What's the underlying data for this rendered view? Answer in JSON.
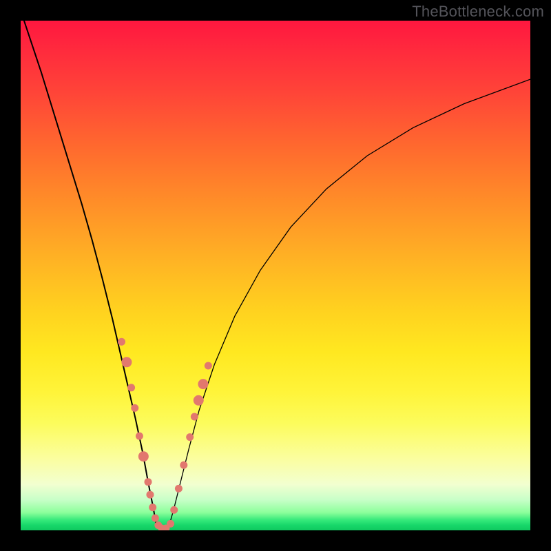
{
  "watermark": {
    "text": "TheBottleneck.com"
  },
  "chart_data": {
    "type": "line",
    "title": "",
    "xlabel": "",
    "ylabel": "",
    "xlim": [
      0,
      100
    ],
    "ylim": [
      0,
      100
    ],
    "series": [
      {
        "name": "curve-left",
        "x": [
          0,
          4,
          8,
          12,
          14,
          16,
          18,
          19.5,
          21,
          22.5,
          24,
          25,
          26,
          26.7
        ],
        "y": [
          102,
          90,
          77,
          64,
          57,
          49.5,
          41.5,
          35,
          28.5,
          22,
          15,
          9.5,
          4.5,
          0.5
        ]
      },
      {
        "name": "curve-right",
        "x": [
          29,
          30,
          31.5,
          33,
          35,
          38,
          42,
          47,
          53,
          60,
          68,
          77,
          87,
          100
        ],
        "y": [
          0.5,
          4,
          10,
          16,
          23.5,
          32.5,
          42,
          51,
          59.5,
          67,
          73.5,
          79,
          83.7,
          88.5
        ]
      }
    ],
    "markers": [
      {
        "x": 19.8,
        "y": 37,
        "r": 5.5
      },
      {
        "x": 20.8,
        "y": 33,
        "r": 7.5
      },
      {
        "x": 21.7,
        "y": 28,
        "r": 5.5
      },
      {
        "x": 22.4,
        "y": 24,
        "r": 5.5
      },
      {
        "x": 23.3,
        "y": 18.5,
        "r": 5.5
      },
      {
        "x": 24.1,
        "y": 14.5,
        "r": 7.5
      },
      {
        "x": 25.0,
        "y": 9.5,
        "r": 5.5
      },
      {
        "x": 25.4,
        "y": 7,
        "r": 5.5
      },
      {
        "x": 25.9,
        "y": 4.5,
        "r": 5.5
      },
      {
        "x": 26.4,
        "y": 2.4,
        "r": 5.5
      },
      {
        "x": 27.0,
        "y": 1.0,
        "r": 5.5
      },
      {
        "x": 27.7,
        "y": 0.4,
        "r": 5.5
      },
      {
        "x": 28.5,
        "y": 0.4,
        "r": 5.5
      },
      {
        "x": 29.4,
        "y": 1.3,
        "r": 5.5
      },
      {
        "x": 30.1,
        "y": 4.0,
        "r": 5.5
      },
      {
        "x": 31.0,
        "y": 8.2,
        "r": 5.5
      },
      {
        "x": 32.0,
        "y": 12.8,
        "r": 5.5
      },
      {
        "x": 33.2,
        "y": 18.3,
        "r": 5.5
      },
      {
        "x": 34.1,
        "y": 22.3,
        "r": 5.5
      },
      {
        "x": 34.9,
        "y": 25.5,
        "r": 7.5
      },
      {
        "x": 35.8,
        "y": 28.7,
        "r": 7.5
      },
      {
        "x": 36.8,
        "y": 32.3,
        "r": 5.5
      }
    ],
    "marker_color": "#e2786e",
    "curve_color": "#000000"
  }
}
